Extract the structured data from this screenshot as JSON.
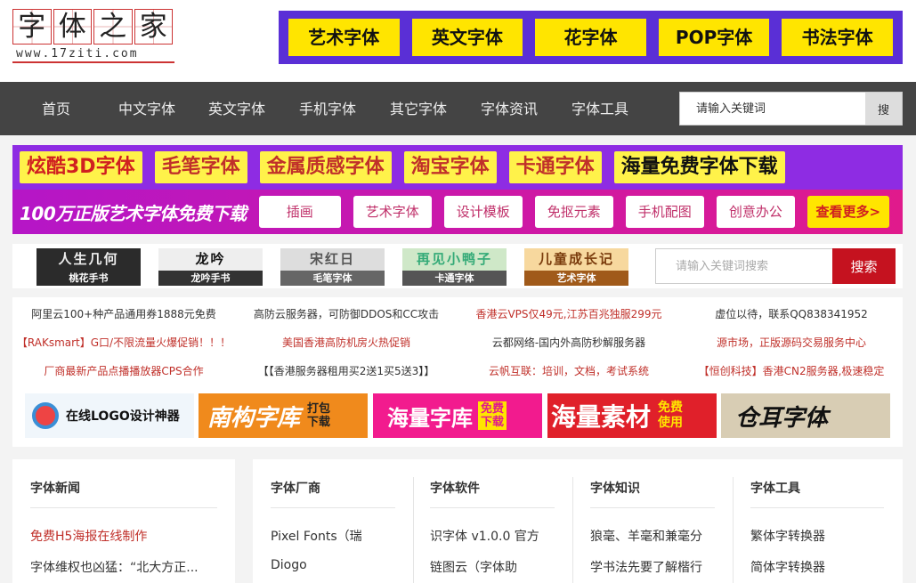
{
  "logo": {
    "chars": [
      "字",
      "体",
      "之",
      "家"
    ],
    "url": "www.17ziti.com"
  },
  "top_tabs": [
    "艺术字体",
    "英文字体",
    "花字体",
    "POP字体",
    "书法字体"
  ],
  "nav": {
    "items": [
      "首页",
      "中文字体",
      "英文字体",
      "手机字体",
      "其它字体",
      "字体资讯",
      "字体工具"
    ],
    "search_placeholder": "请输入关键词",
    "search_button": "搜"
  },
  "banner1": [
    "炫酷3D字体",
    "毛笔字体",
    "金属质感字体",
    "淘宝字体",
    "卡通字体",
    "海量免费字体下载"
  ],
  "banner2": {
    "headline": "100万正版艺术字体免费下载",
    "buttons": [
      "插画",
      "艺术字体",
      "设计模板",
      "免抠元素",
      "手机配图",
      "创意办公"
    ],
    "more": "查看更多>"
  },
  "samples": [
    {
      "art": "人生几何",
      "label": "桃花手书"
    },
    {
      "art": "龙吟",
      "label": "龙吟手书"
    },
    {
      "art": "宋红日",
      "label": "毛笔字体"
    },
    {
      "art": "再见小鸭子",
      "label": "卡通字体"
    },
    {
      "art": "儿童成长记",
      "label": "艺术字体"
    }
  ],
  "sample_search": {
    "placeholder": "请输入关键词搜索",
    "button": "搜索"
  },
  "ads": [
    {
      "text": "阿里云100+种产品通用券1888元免费",
      "color": "#333333"
    },
    {
      "text": "高防云服务器，可防御DDOS和CC攻击",
      "color": "#333333"
    },
    {
      "text": "香港云VPS仅49元,江苏百兆独服299元",
      "color": "#c0302a"
    },
    {
      "text": "虚位以待，联系QQ838341952",
      "color": "#333333"
    },
    {
      "text": "【RAKsmart】G口/不限流量火爆促销！！！",
      "color": "#c0302a"
    },
    {
      "text": "美国香港高防机房火热促销",
      "color": "#c0302a"
    },
    {
      "text": "云都网络-国内外高防秒解服务器",
      "color": "#333333"
    },
    {
      "text": "源市场，正版源码交易服务中心",
      "color": "#c0302a"
    },
    {
      "text": "厂商最新产品点播播放器CPS合作",
      "color": "#c0302a"
    },
    {
      "text": "【【香港服务器租用买2送1买5送3】】",
      "color": "#333333"
    },
    {
      "text": "云帆互联：培训，文档，考试系统",
      "color": "#c0302a"
    },
    {
      "text": "【恒创科技】香港CN2服务器,极速稳定",
      "color": "#c0302a"
    }
  ],
  "image_banners": [
    {
      "main": "在线LOGO设计神器",
      "small": ""
    },
    {
      "main": "南构字库",
      "small": "打包下载"
    },
    {
      "main": "海量字库",
      "small": "免费下载"
    },
    {
      "main": "海量素材",
      "small": "免费使用"
    },
    {
      "main": "仓耳字体",
      "small": ""
    }
  ],
  "panels": {
    "news": {
      "title": "字体新闻",
      "items": [
        "免费H5海报在线制作",
        "字体维权也凶猛：“北大方正..."
      ]
    },
    "vendors": {
      "title": "字体厂商",
      "items": [
        "Pixel Fonts（瑞",
        "Diogo"
      ]
    },
    "software": {
      "title": "字体软件",
      "items": [
        "识字体 v1.0.0 官方",
        "链图云（字体助"
      ]
    },
    "knowledge": {
      "title": "字体知识",
      "items": [
        "狼毫、羊毫和兼毫分",
        "学书法先要了解楷行"
      ]
    },
    "tools": {
      "title": "字体工具",
      "items": [
        "繁体字转换器",
        "简体字转换器"
      ]
    }
  },
  "colors": {
    "brand_purple": "#5a2fd6",
    "tab_yellow": "#ffe500",
    "nav_bg": "#444444",
    "accent_red": "#c5121f"
  }
}
